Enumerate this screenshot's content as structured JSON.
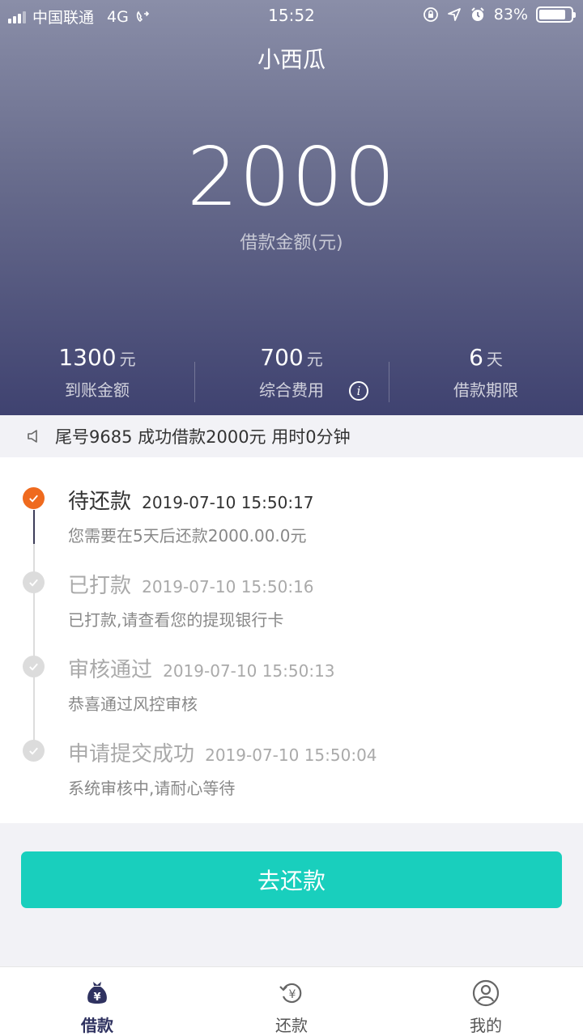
{
  "status_bar": {
    "carrier": "中国联通",
    "network": "4G",
    "time": "15:52",
    "battery": "83%"
  },
  "header": {
    "title": "小西瓜",
    "amount": "2000",
    "amount_label": "借款金额(元)"
  },
  "stats": [
    {
      "value": "1300",
      "unit": "元",
      "label": "到账金额"
    },
    {
      "value": "700",
      "unit": "元",
      "label": "综合费用",
      "info_icon": "i"
    },
    {
      "value": "6",
      "unit": "天",
      "label": "借款期限"
    }
  ],
  "notice": {
    "text": "尾号9685 成功借款2000元 用时0分钟",
    "icon": "speaker-icon"
  },
  "timeline": [
    {
      "title": "待还款",
      "time": "2019-07-10 15:50:17",
      "desc": "您需要在5天后还款2000.00.0元",
      "state": "active"
    },
    {
      "title": "已打款",
      "time": "2019-07-10 15:50:16",
      "desc": "已打款,请查看您的提现银行卡",
      "state": "done"
    },
    {
      "title": "审核通过",
      "time": "2019-07-10 15:50:13",
      "desc": "恭喜通过风控审核",
      "state": "done"
    },
    {
      "title": "申请提交成功",
      "time": "2019-07-10 15:50:04",
      "desc": "系统审核中,请耐心等待",
      "state": "done"
    }
  ],
  "button": {
    "label": "去还款"
  },
  "tabbar": [
    {
      "label": "借款",
      "icon": "money-bag-icon",
      "active": true
    },
    {
      "label": "还款",
      "icon": "repay-icon",
      "active": false
    },
    {
      "label": "我的",
      "icon": "user-icon",
      "active": false
    }
  ],
  "colors": {
    "accent": "#19cfbd",
    "active_step": "#ef6a1e",
    "header_bottom": "#3f4270",
    "tab_active": "#2f3260"
  }
}
